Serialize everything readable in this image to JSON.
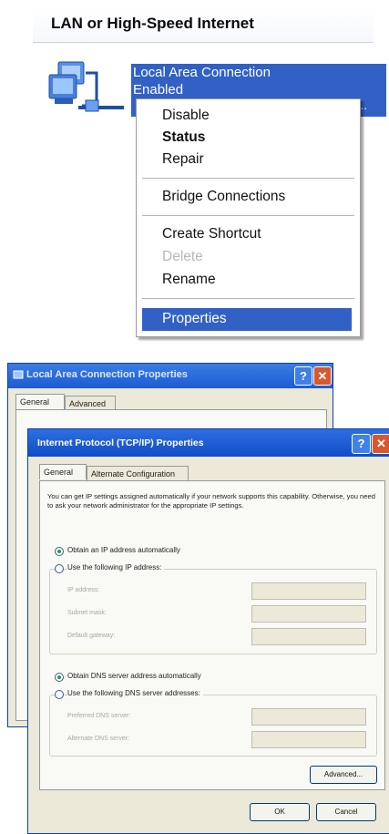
{
  "connections_panel": {
    "section_title": "LAN or High-Speed Internet",
    "connection": {
      "name": "Local Area Connection",
      "status": "Enabled",
      "more": "..."
    },
    "context_menu": {
      "disable": "Disable",
      "status": "Status",
      "repair": "Repair",
      "bridge": "Bridge Connections",
      "shortcut": "Create Shortcut",
      "delete": "Delete",
      "rename": "Rename",
      "properties": "Properties"
    }
  },
  "back_dialog": {
    "title": "Local Area Connection Properties",
    "tabs": [
      "General",
      "Advanced"
    ]
  },
  "front_dialog": {
    "title": "Internet Protocol (TCP/IP) Properties",
    "tabs": [
      "General",
      "Alternate Configuration"
    ],
    "description": "You can get IP settings assigned automatically if your network supports this capability. Otherwise, you need to ask your network administrator for the appropriate IP settings.",
    "ip": {
      "auto_label": "Obtain an IP address automatically",
      "manual_label": "Use the following IP address:",
      "fields": [
        "IP address:",
        "Subnet mask:",
        "Default gateway:"
      ]
    },
    "dns": {
      "auto_label": "Obtain DNS server address automatically",
      "manual_label": "Use the following DNS server addresses:",
      "fields": [
        "Preferred DNS server:",
        "Alternate DNS server:"
      ]
    },
    "buttons": {
      "advanced": "Advanced...",
      "ok": "OK",
      "cancel": "Cancel"
    }
  },
  "colors": {
    "selection": "#3161c5",
    "title_bar": "#1c5bd5",
    "dialog_bg": "#ece9d8"
  }
}
